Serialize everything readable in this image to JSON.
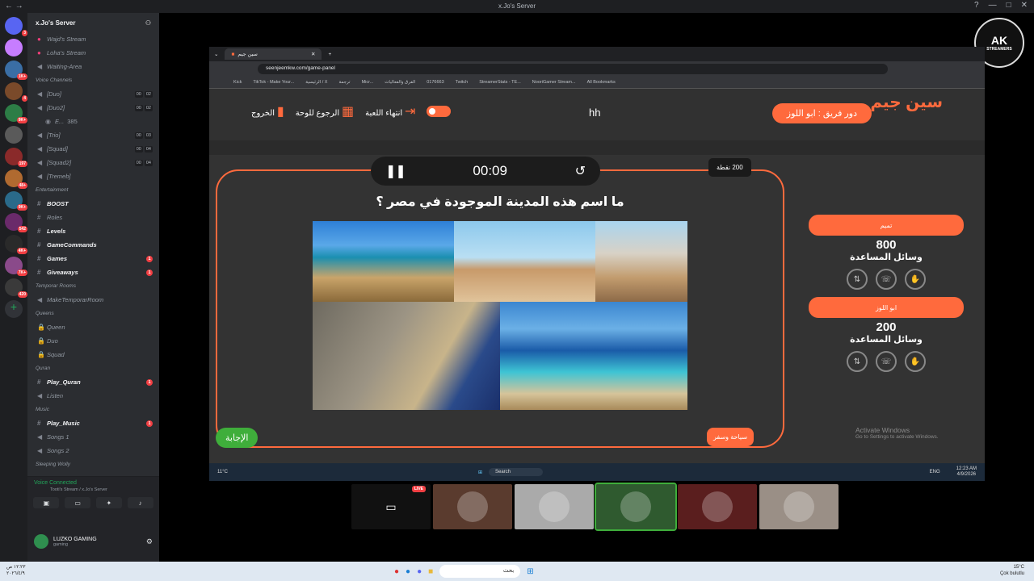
{
  "window": {
    "title": "x.Jo's Server"
  },
  "server": {
    "name": "x.Jo's Server",
    "guild_badges": [
      "3",
      "",
      "1K+",
      "4",
      "9K+",
      "",
      "197",
      "48+",
      "9K+",
      "542",
      "4K+",
      "7K+",
      "420"
    ]
  },
  "channels": [
    {
      "kind": "voice",
      "name": "Wajd's Stream",
      "icon": "live-icon"
    },
    {
      "kind": "voice",
      "name": "Loha's Stream",
      "icon": "live-icon"
    },
    {
      "kind": "voice",
      "name": "Waiting-Area",
      "icon": "speaker-icon"
    },
    {
      "kind": "category",
      "name": "Voice Channels"
    },
    {
      "kind": "voice",
      "name": "[Duo]",
      "icon": "speaker-icon",
      "counts": [
        "00",
        "02"
      ]
    },
    {
      "kind": "voice",
      "name": "[Duo2]",
      "icon": "speaker-icon",
      "counts": [
        "00",
        "02"
      ]
    },
    {
      "kind": "user",
      "name": "E...",
      "extra": "385"
    },
    {
      "kind": "voice",
      "name": "[Trio]",
      "icon": "speaker-icon",
      "counts": [
        "00",
        "03"
      ]
    },
    {
      "kind": "voice",
      "name": "[Squad]",
      "icon": "speaker-icon",
      "counts": [
        "00",
        "04"
      ]
    },
    {
      "kind": "voice",
      "name": "[Squad2]",
      "icon": "speaker-icon",
      "counts": [
        "00",
        "04"
      ]
    },
    {
      "kind": "voice",
      "name": "[Tremeb]",
      "icon": "speaker-icon"
    },
    {
      "kind": "category",
      "name": "Entertainment"
    },
    {
      "kind": "text",
      "name": "BOOST",
      "bold": true
    },
    {
      "kind": "text",
      "name": "Roles"
    },
    {
      "kind": "text",
      "name": "Levels",
      "bold": true
    },
    {
      "kind": "text",
      "name": "GameCommands",
      "bold": true
    },
    {
      "kind": "text",
      "name": "Games",
      "bold": true,
      "unread": "1"
    },
    {
      "kind": "text",
      "name": "Giveaways",
      "bold": true,
      "unread": "1"
    },
    {
      "kind": "category",
      "name": "Temporar Rooms"
    },
    {
      "kind": "voice",
      "name": "MakeTemporarRoom",
      "icon": "speaker-icon"
    },
    {
      "kind": "category",
      "name": "Queens"
    },
    {
      "kind": "voice",
      "name": "Queen",
      "icon": "lock-icon"
    },
    {
      "kind": "voice",
      "name": "Duo",
      "icon": "lock-icon"
    },
    {
      "kind": "voice",
      "name": "Squad",
      "icon": "lock-icon"
    },
    {
      "kind": "category",
      "name": "Quran"
    },
    {
      "kind": "text",
      "name": "Play_Quran",
      "bold": true,
      "unread": "1"
    },
    {
      "kind": "voice",
      "name": "Listen",
      "icon": "speaker-icon"
    },
    {
      "kind": "category",
      "name": "Music"
    },
    {
      "kind": "text",
      "name": "Play_Music",
      "bold": true,
      "unread": "1"
    },
    {
      "kind": "voice",
      "name": "Songs 1",
      "icon": "speaker-icon"
    },
    {
      "kind": "voice",
      "name": "Songs 2",
      "icon": "speaker-icon"
    },
    {
      "kind": "category",
      "name": "Sleeping Wolly"
    }
  ],
  "voice_panel": {
    "status": "Voice Connected",
    "sub": "Tooti's Stream / x.Jo's Server"
  },
  "user": {
    "name": "LUZKO GAMING",
    "status": "gaming"
  },
  "browser": {
    "tab_title": "سين جيم",
    "url": "seenjeemkw.com/game-panel",
    "bookmarks": [
      "Kick",
      "TikTok - Make Your...",
      "الرئيسية / X",
      "ترجمة",
      "Micr...",
      "الفرق والفعاليات",
      "0176663",
      "Twitch",
      "StreamerStats - TE...",
      "NooriGamer Stream...",
      "All Bookmarks"
    ]
  },
  "game": {
    "logo": "سين جيم",
    "turn_label": "دور فريق : ابو اللوز",
    "center_text": "hh",
    "end_game": "انتهاء اللعبة",
    "back_to_board": "الرجوع للوحة",
    "exit": "الخروج",
    "timer": "00:09",
    "points": "200 نقطة",
    "question": "ما اسم هذه المدينة الموجودة في مصر ؟",
    "answer_button": "الإجابة",
    "category": "سياحة وسفر",
    "teams": [
      {
        "name": "تميم",
        "score": "800",
        "helpers_label": "وسائل المساعدة"
      },
      {
        "name": "ابو اللوز",
        "score": "200",
        "helpers_label": "وسائل المساعدة"
      }
    ]
  },
  "inner_taskbar": {
    "search": "Search",
    "weather": "11°C",
    "lang": "ENG",
    "time": "12:23 AM",
    "date": "4/9/2026"
  },
  "activate_windows": {
    "title": "Activate Windows",
    "sub": "Go to Settings to activate Windows."
  },
  "stream_logo": {
    "main": "AK",
    "sub": "STREAMERS"
  },
  "participants": [
    {
      "label": "screen-share",
      "live": "LIVE",
      "color": "#111111"
    },
    {
      "label": "user-1",
      "color": "#5a3b2e"
    },
    {
      "label": "user-2",
      "color": "#aaaaaa"
    },
    {
      "label": "user-3",
      "color": "#2f5a2f"
    },
    {
      "label": "user-4",
      "color": "#5a1e1e"
    },
    {
      "label": "user-5",
      "color": "#9a8f86"
    }
  ],
  "host_taskbar": {
    "search": "بحث",
    "time": "١٢:٢٣ ص",
    "date": "٢٠٢٦/٤/٩",
    "weather": "15°C",
    "weather_sub": "Çok bulutlu"
  },
  "colors": {
    "accent": "#ff6a3d",
    "green": "#3fae3b",
    "discord_bg": "#2b2d31"
  }
}
